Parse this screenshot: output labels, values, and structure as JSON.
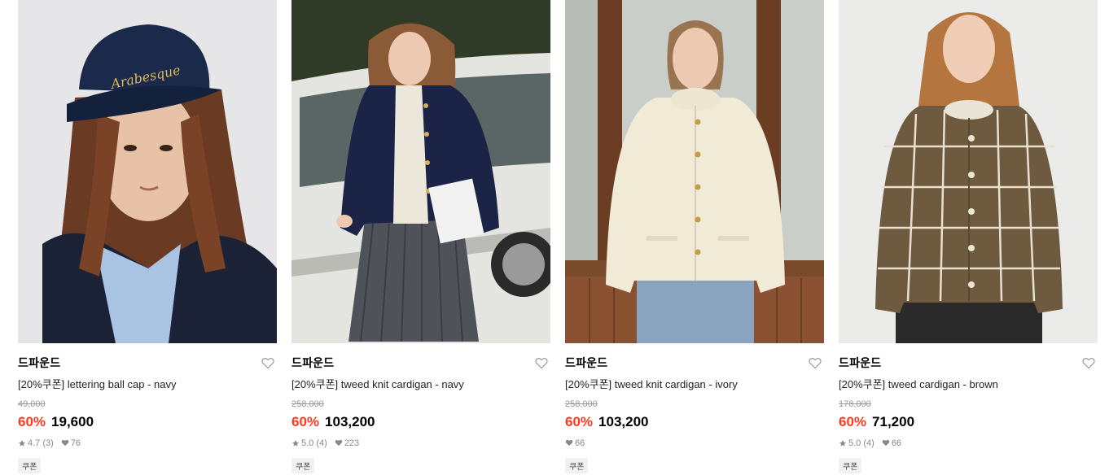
{
  "products": [
    {
      "brand": "드파운드",
      "name": "[20%쿠폰] lettering ball cap - navy",
      "original_price": "49,000",
      "discount": "60%",
      "price": "19,600",
      "rating": "4.7",
      "review_count": "(3)",
      "likes": "76",
      "tag": "쿠폰",
      "cap_text": "Arabesque"
    },
    {
      "brand": "드파운드",
      "name": "[20%쿠폰] tweed knit cardigan - navy",
      "original_price": "258,000",
      "discount": "60%",
      "price": "103,200",
      "rating": "5.0",
      "review_count": "(4)",
      "likes": "223",
      "tag": "쿠폰"
    },
    {
      "brand": "드파운드",
      "name": "[20%쿠폰] tweed knit cardigan - ivory",
      "original_price": "258,000",
      "discount": "60%",
      "price": "103,200",
      "likes": "66",
      "tag": "쿠폰"
    },
    {
      "brand": "드파운드",
      "name": "[20%쿠폰] tweed cardigan - brown",
      "original_price": "178,000",
      "discount": "60%",
      "price": "71,200",
      "rating": "5.0",
      "review_count": "(4)",
      "likes": "66",
      "tag": "쿠폰"
    }
  ],
  "colors": {
    "discount": "#ff3b1f",
    "text": "#000000",
    "muted": "#999999",
    "tag_bg": "#f1f1f1"
  }
}
